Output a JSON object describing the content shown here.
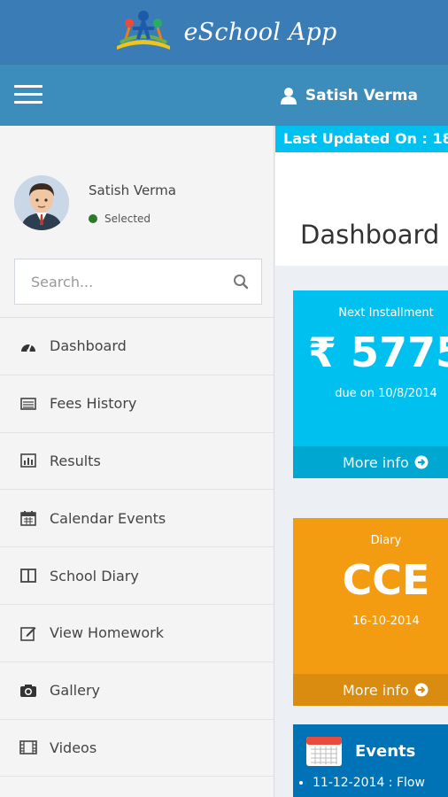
{
  "app": {
    "title": "eSchool App"
  },
  "navbar": {
    "user_name": "Satish Verma"
  },
  "sidebar": {
    "user": {
      "name": "Satish Verma",
      "status": "Selected"
    },
    "search": {
      "placeholder": "Search..."
    },
    "items": [
      {
        "label": "Dashboard",
        "icon": "dashboard-icon"
      },
      {
        "label": "Fees History",
        "icon": "fees-history-icon"
      },
      {
        "label": "Results",
        "icon": "results-chart-icon"
      },
      {
        "label": "Calendar Events",
        "icon": "calendar-icon"
      },
      {
        "label": "School Diary",
        "icon": "book-icon"
      },
      {
        "label": "View Homework",
        "icon": "edit-icon"
      },
      {
        "label": "Gallery",
        "icon": "camera-icon"
      },
      {
        "label": "Videos",
        "icon": "film-icon"
      }
    ]
  },
  "content": {
    "last_updated": "Last Updated On : 18",
    "page_title": "Dashboard",
    "installment": {
      "label": "Next Installment",
      "amount": "₹ 5775",
      "due": "due on 10/8/2014",
      "more": "More info"
    },
    "diary": {
      "label": "Diary",
      "value": "CCE",
      "date": "16-10-2014",
      "more": "More info"
    },
    "events": {
      "title": "Events",
      "items": [
        "11-12-2014 : Flow"
      ]
    }
  },
  "colors": {
    "header": "#3a7db6",
    "navbar": "#3c8dbc",
    "aqua": "#00c0ef",
    "orange": "#f39c12",
    "blue": "#0073b7"
  }
}
